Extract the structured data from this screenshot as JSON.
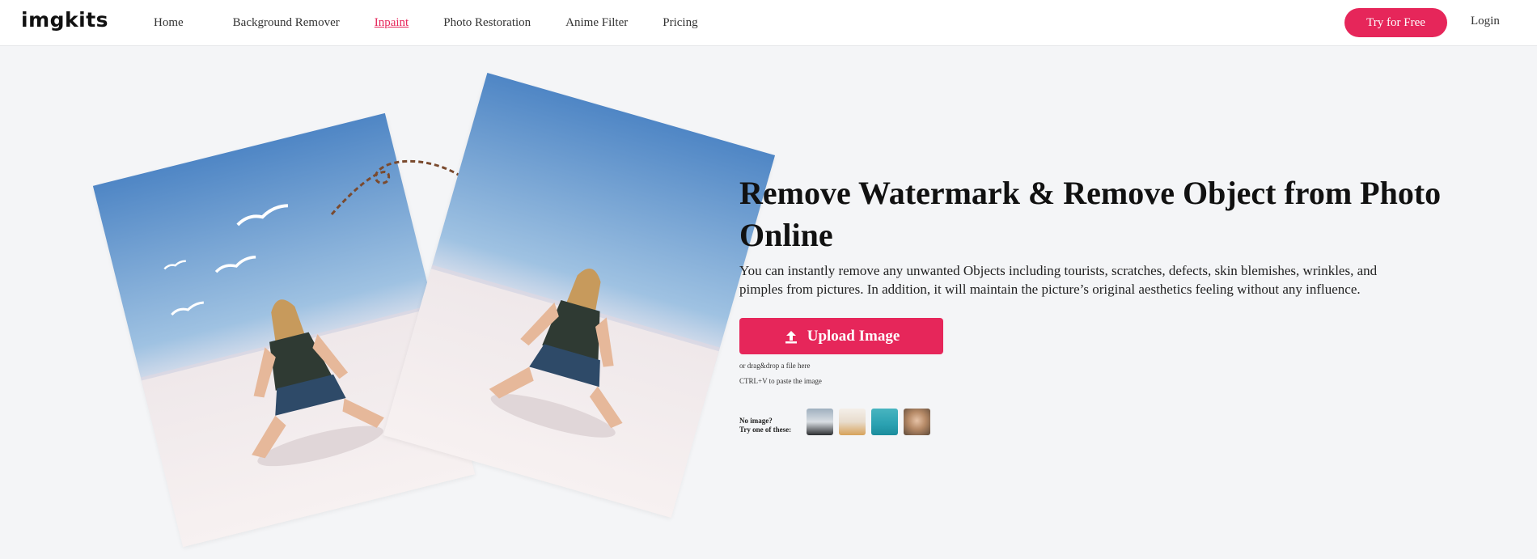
{
  "header": {
    "logo": "imgkits",
    "nav": [
      {
        "label": "Home",
        "active": false
      },
      {
        "label": "Background Remover",
        "active": false
      },
      {
        "label": "Inpaint",
        "active": true
      },
      {
        "label": "Photo Restoration",
        "active": false
      },
      {
        "label": "Anime Filter",
        "active": false
      },
      {
        "label": "Pricing",
        "active": false
      }
    ],
    "try_button": "Try for Free",
    "login": "Login"
  },
  "hero": {
    "title": "Remove Watermark & Remove Object from Photo Online",
    "description": "You can instantly remove any unwanted Objects including tourists, scratches, defects, skin blemishes, wrinkles, and pimples from pictures. In addition, it will maintain the picture’s original aesthetics feeling without any influence.",
    "upload_button": "Upload Image",
    "upload_icon": "upload-icon",
    "hint_drag": "or drag&drop a file here",
    "hint_paste": "CTRL+V to paste the image",
    "no_image_line1": "No image?",
    "no_image_line2": "Try one of these:",
    "samples": [
      "sample-1",
      "sample-2",
      "sample-3",
      "sample-4"
    ]
  },
  "colors": {
    "accent": "#e6265a",
    "background": "#f4f5f7"
  }
}
